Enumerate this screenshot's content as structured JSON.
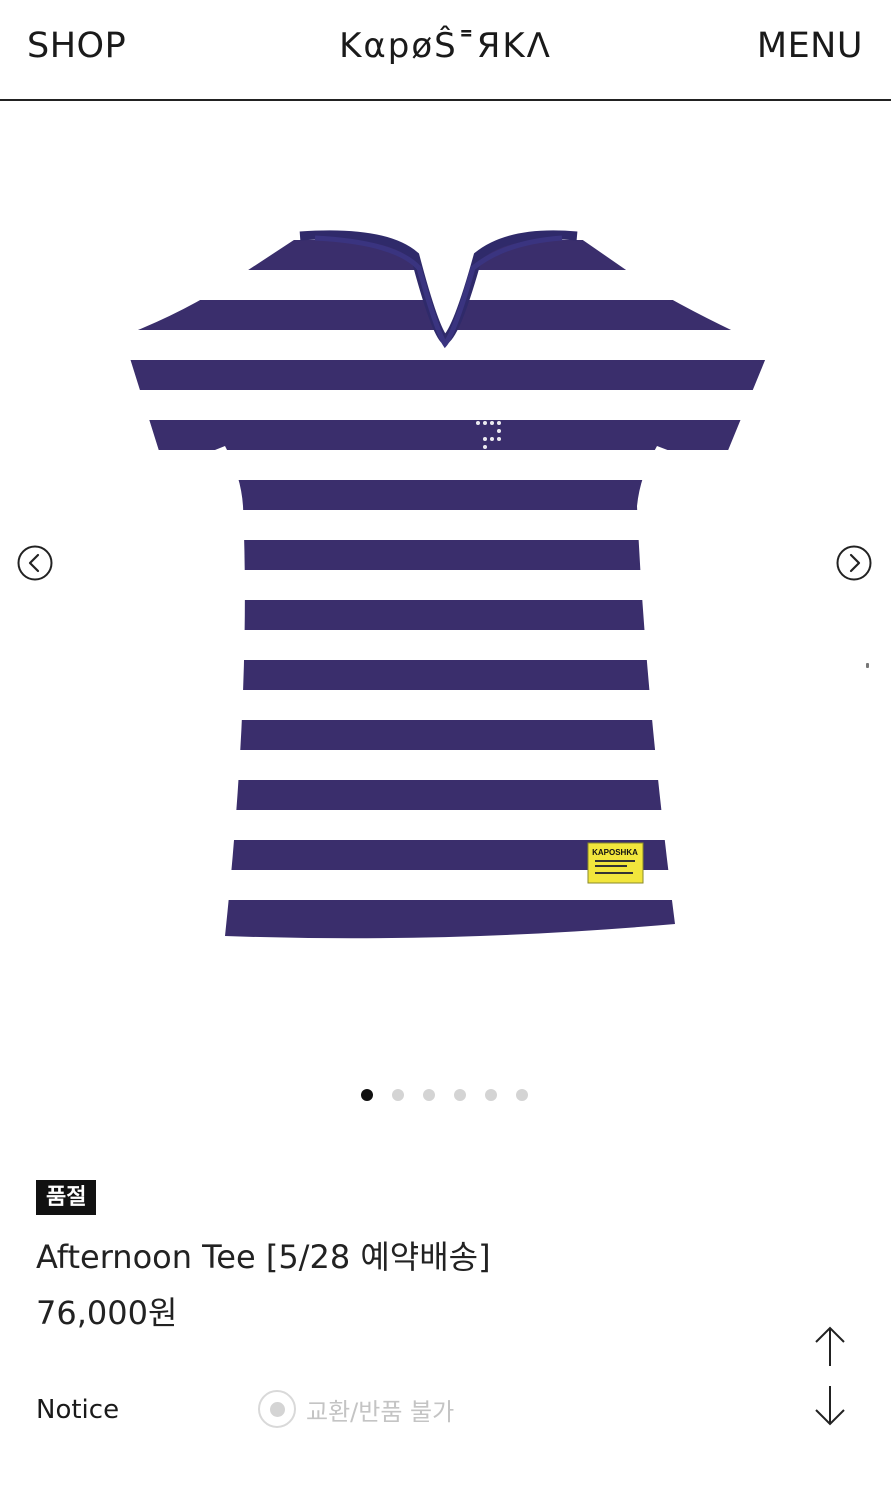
{
  "header": {
    "shop_label": "SHOP",
    "logo_text": "KαpøŜ˭ЯKΛ",
    "menu_label": "MENU"
  },
  "product": {
    "image_icon": "striped-vneck-tee",
    "label_text": "KAPOSHKA",
    "soldout_badge": "품절",
    "name": "Afternoon Tee [5/28 예약배송]",
    "price": "76,000원"
  },
  "gallery": {
    "prev_icon": "chevron-left-circle",
    "next_icon": "chevron-right-circle",
    "dot_count": 6,
    "active_dot": 1
  },
  "notice": {
    "label": "Notice",
    "option_label": "교환/반품 불가"
  },
  "scroll": {
    "up_icon": "arrow-up",
    "down_icon": "arrow-down"
  },
  "colors": {
    "stripe": "#3a2e6c",
    "badge_bg": "#111111",
    "tag_yellow": "#f2e63c"
  }
}
